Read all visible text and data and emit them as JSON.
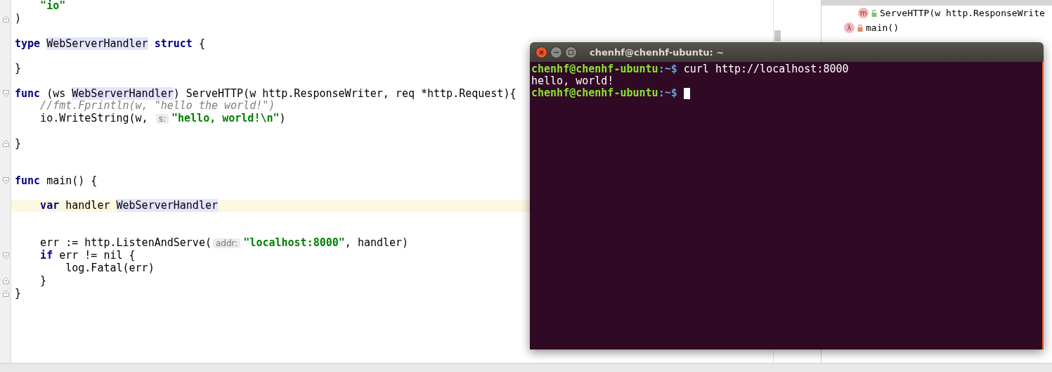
{
  "editor": {
    "lines": [
      {
        "kind": "code",
        "current": false,
        "tokens": [
          {
            "kind": "string",
            "text": "    \"io\""
          }
        ]
      },
      {
        "kind": "fold_end",
        "current": false,
        "tokens": [
          {
            "kind": "plain",
            "text": ")"
          }
        ]
      },
      {
        "kind": "blank"
      },
      {
        "kind": "code",
        "current": false,
        "tokens": [
          {
            "kind": "keyword",
            "text": "type "
          },
          {
            "kind": "usage",
            "text": "WebServerHandler"
          },
          {
            "kind": "keyword",
            "text": " struct"
          },
          {
            "kind": "plain",
            "text": " {"
          }
        ]
      },
      {
        "kind": "blank"
      },
      {
        "kind": "code",
        "current": false,
        "tokens": [
          {
            "kind": "plain",
            "text": "}"
          }
        ]
      },
      {
        "kind": "blank"
      },
      {
        "kind": "fold_start",
        "current": false,
        "tokens": [
          {
            "kind": "keyword",
            "text": "func"
          },
          {
            "kind": "plain",
            "text": " (ws "
          },
          {
            "kind": "usage",
            "text": "WebServerHandler"
          },
          {
            "kind": "plain",
            "text": ") ServeHTTP(w http.ResponseWriter, req *http.Request){"
          }
        ]
      },
      {
        "kind": "code",
        "current": false,
        "tokens": [
          {
            "kind": "comment",
            "text": "    //fmt.Fprintln(w, \"hello the world!\")"
          }
        ]
      },
      {
        "kind": "code",
        "current": false,
        "tokens": [
          {
            "kind": "plain",
            "text": "    io.WriteString(w, "
          },
          {
            "kind": "hint",
            "text": "s:"
          },
          {
            "kind": "string",
            "text": "\"hello, world!\\n\""
          },
          {
            "kind": "plain",
            "text": ")"
          }
        ]
      },
      {
        "kind": "blank"
      },
      {
        "kind": "fold_end",
        "current": false,
        "tokens": [
          {
            "kind": "plain",
            "text": "}"
          }
        ]
      },
      {
        "kind": "blank"
      },
      {
        "kind": "blank"
      },
      {
        "kind": "fold_start",
        "current": false,
        "tokens": [
          {
            "kind": "keyword",
            "text": "func"
          },
          {
            "kind": "plain",
            "text": " main() {"
          }
        ]
      },
      {
        "kind": "blank"
      },
      {
        "kind": "code",
        "current": true,
        "tokens": [
          {
            "kind": "keyword",
            "text": "    var"
          },
          {
            "kind": "plain",
            "text": " handler "
          },
          {
            "kind": "usage",
            "text": "WebServerHandler"
          }
        ]
      },
      {
        "kind": "blank"
      },
      {
        "kind": "blank"
      },
      {
        "kind": "code",
        "current": false,
        "tokens": [
          {
            "kind": "plain",
            "text": "    err := http.ListenAndServe("
          },
          {
            "kind": "hint",
            "text": "addr:"
          },
          {
            "kind": "string",
            "text": "\"localhost:8000\""
          },
          {
            "kind": "plain",
            "text": ", handler)"
          }
        ]
      },
      {
        "kind": "fold_start",
        "current": false,
        "tokens": [
          {
            "kind": "keyword",
            "text": "    if"
          },
          {
            "kind": "plain",
            "text": " err != nil {"
          }
        ]
      },
      {
        "kind": "code",
        "current": false,
        "tokens": [
          {
            "kind": "plain",
            "text": "        log.Fatal(err)"
          }
        ]
      },
      {
        "kind": "fold_end",
        "current": false,
        "tokens": [
          {
            "kind": "plain",
            "text": "    }"
          }
        ]
      },
      {
        "kind": "fold_end",
        "current": false,
        "tokens": [
          {
            "kind": "plain",
            "text": "}"
          }
        ]
      }
    ]
  },
  "structure": {
    "items": [
      {
        "kind": "method",
        "icon": "m",
        "label": "ServeHTTP(w http.ResponseWrite",
        "selected": false
      },
      {
        "kind": "function",
        "icon": "λ",
        "label": "main()",
        "selected": false
      }
    ]
  },
  "terminal": {
    "title": "chenhf@chenhf-ubuntu: ~",
    "lines": [
      {
        "kind": "command",
        "prompt": "chenhf@chenhf-ubuntu",
        "path": ":~$",
        "text": " curl http://localhost:8000"
      },
      {
        "kind": "output",
        "text": "hello, world!"
      },
      {
        "kind": "command",
        "prompt": "chenhf@chenhf-ubuntu",
        "path": ":~$",
        "cursor": true
      }
    ]
  }
}
